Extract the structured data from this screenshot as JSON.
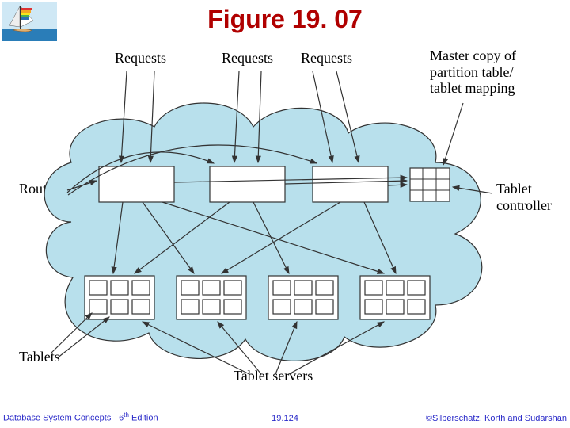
{
  "title": "Figure 19. 07",
  "labels": {
    "requests1": "Requests",
    "requests2": "Requests",
    "requests3": "Requests",
    "master_copy_l1": "Master copy of",
    "master_copy_l2": "partition table/",
    "master_copy_l3": "tablet mapping",
    "routers": "Routers",
    "tablet_controller_l1": "Tablet",
    "tablet_controller_l2": "controller",
    "tablets": "Tablets",
    "tablet_servers": "Tablet servers"
  },
  "footer": {
    "left_prefix": "Database System Concepts - 6",
    "left_sup": "th",
    "left_suffix": " Edition",
    "center": "19.124",
    "right": "©Silberschatz, Korth and Sudarshan"
  }
}
